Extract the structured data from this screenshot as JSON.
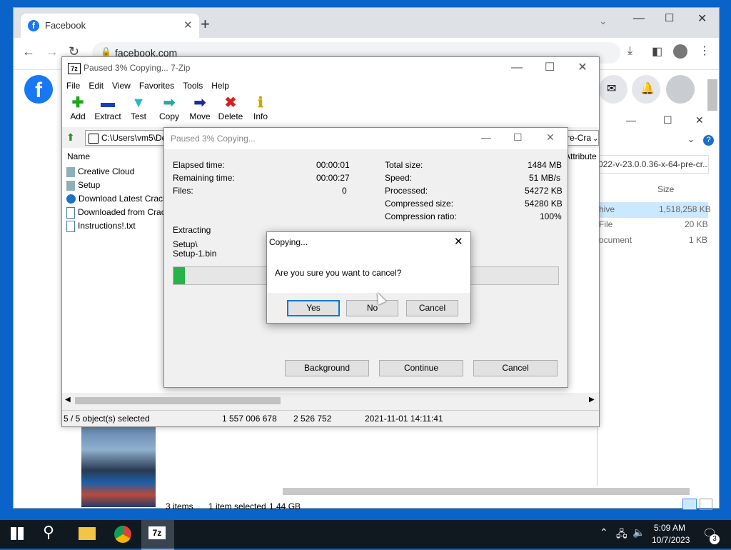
{
  "colors": {
    "taskbar": "#101820",
    "desktop": "#0a63c9",
    "progress": "#26b347",
    "facebook": "#1877f2"
  },
  "chrome": {
    "tab_title": "Facebook",
    "url": "facebook.com",
    "new_tab": "+"
  },
  "explorer": {
    "path_fragment": "022-v-23.0.0.36-x-64-pre-cr...",
    "column_size": "Size",
    "rows": [
      {
        "type": "hive",
        "size": "1,518,258 KB"
      },
      {
        "type": "File",
        "size": "20 KB"
      },
      {
        "type": "ocument",
        "size": "1 KB"
      }
    ],
    "status_items": "3 items",
    "status_selected": "1 item selected",
    "status_size": "1.44 GB"
  },
  "zip": {
    "title": "Paused 3% Copying... 7-Zip",
    "menu": [
      "File",
      "Edit",
      "View",
      "Favorites",
      "Tools",
      "Help"
    ],
    "toolbar": [
      {
        "label": "Add",
        "icon": "add-icon",
        "glyph": "✚",
        "color": "#1aa81a"
      },
      {
        "label": "Extract",
        "icon": "extract-icon",
        "glyph": "▬",
        "color": "#1a3ac8"
      },
      {
        "label": "Test",
        "icon": "test-icon",
        "glyph": "▼",
        "color": "#25b8c8"
      },
      {
        "label": "Copy",
        "icon": "copy-icon",
        "glyph": "➡",
        "color": "#2aa8a0"
      },
      {
        "label": "Move",
        "icon": "move-icon",
        "glyph": "➡",
        "color": "#1a2a9a"
      },
      {
        "label": "Delete",
        "icon": "delete-icon",
        "glyph": "✖",
        "color": "#d81e1e"
      },
      {
        "label": "Info",
        "icon": "info-icon",
        "glyph": "ℹ",
        "color": "#c8a800"
      }
    ],
    "address": "C:\\Users\\vm5\\De",
    "address_right": "re-Cra",
    "col_name": "Name",
    "col_attr": "Attribute",
    "files": [
      {
        "name": "Creative Cloud",
        "icon": "folder-icon"
      },
      {
        "name": "Setup",
        "icon": "folder-icon"
      },
      {
        "name": "Download Latest Crack",
        "icon": "globe-icon"
      },
      {
        "name": "Downloaded from Crac",
        "icon": "text-file-icon"
      },
      {
        "name": "Instructions!.txt",
        "icon": "text-file-icon"
      }
    ],
    "status": {
      "selected": "5 / 5 object(s) selected",
      "size": "1 557 006 678",
      "packed": "2 526 752",
      "date": "2021-11-01 14:11:41"
    }
  },
  "progress": {
    "title": "Paused 3% Copying...",
    "elapsed_label": "Elapsed time:",
    "elapsed": "00:00:01",
    "remaining_label": "Remaining time:",
    "remaining": "00:00:27",
    "files_label": "Files:",
    "files": "0",
    "total_label": "Total size:",
    "total": "1484 MB",
    "speed_label": "Speed:",
    "speed": "51 MB/s",
    "processed_label": "Processed:",
    "processed": "54272 KB",
    "compressed_label": "Compressed size:",
    "compressed": "54280 KB",
    "ratio_label": "Compression ratio:",
    "ratio": "100%",
    "action": "Extracting",
    "path1": "Setup\\",
    "path2": "Setup-1.bin",
    "percent": 0.03,
    "btn_background": "Background",
    "btn_continue": "Continue",
    "btn_cancel": "Cancel"
  },
  "confirm": {
    "title": "Copying...",
    "message": "Are you sure you want to cancel?",
    "yes": "Yes",
    "no": "No",
    "cancel": "Cancel"
  },
  "taskbar": {
    "time": "5:09 AM",
    "date": "10/7/2023",
    "notif_count": "3",
    "zip_label": "7z"
  }
}
